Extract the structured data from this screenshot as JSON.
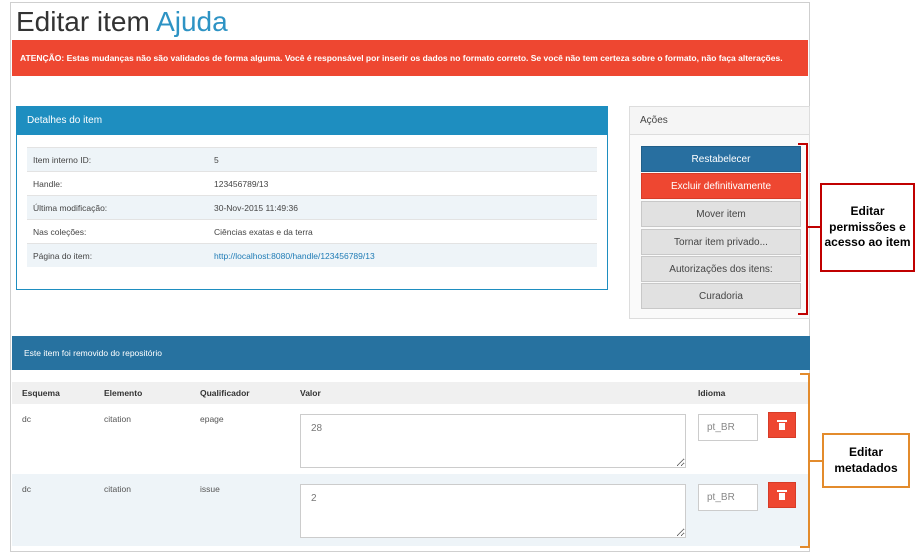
{
  "page": {
    "title_prefix": "Editar item",
    "title_accent": "Ajuda"
  },
  "warning": "ATENÇÃO: Estas mudanças não são validados de forma alguma. Você é responsável por inserir os dados no formato correto. Se você não tem certeza sobre o formato, não faça alterações.",
  "details": {
    "header": "Detalhes do item",
    "rows": [
      {
        "label": "Item interno ID:",
        "value": "5"
      },
      {
        "label": "Handle:",
        "value": "123456789/13"
      },
      {
        "label": "Última modificação:",
        "value": "30-Nov-2015 11:49:36"
      },
      {
        "label": "Nas coleções:",
        "value": "Ciências exatas e da terra"
      },
      {
        "label": "Página do item:",
        "value": "http://localhost:8080/handle/123456789/13"
      }
    ]
  },
  "actions": {
    "header": "Ações",
    "buttons": [
      "Restabelecer",
      "Excluir definitivamente",
      "Mover item",
      "Tornar item privado...",
      "Autorizações dos itens:",
      "Curadoria"
    ]
  },
  "removed_banner": "Este item foi removido do repositório",
  "metadata": {
    "columns": [
      "Esquema",
      "Elemento",
      "Qualificador",
      "Valor",
      "Idioma"
    ],
    "rows": [
      {
        "schema": "dc",
        "element": "citation",
        "qualifier": "epage",
        "value": "28",
        "lang": "pt_BR"
      },
      {
        "schema": "dc",
        "element": "citation",
        "qualifier": "issue",
        "value": "2",
        "lang": "pt_BR"
      }
    ]
  },
  "annotations": {
    "permissions": "Editar permissões e acesso ao item",
    "metadata": "Editar metadados"
  },
  "colors": {
    "accent": "#2d93c4",
    "danger": "#ee4731",
    "primary": "#286fa0",
    "annotation_red": "#c00000",
    "annotation_orange": "#e38b2c"
  },
  "icons": {
    "delete": "trash-icon"
  }
}
